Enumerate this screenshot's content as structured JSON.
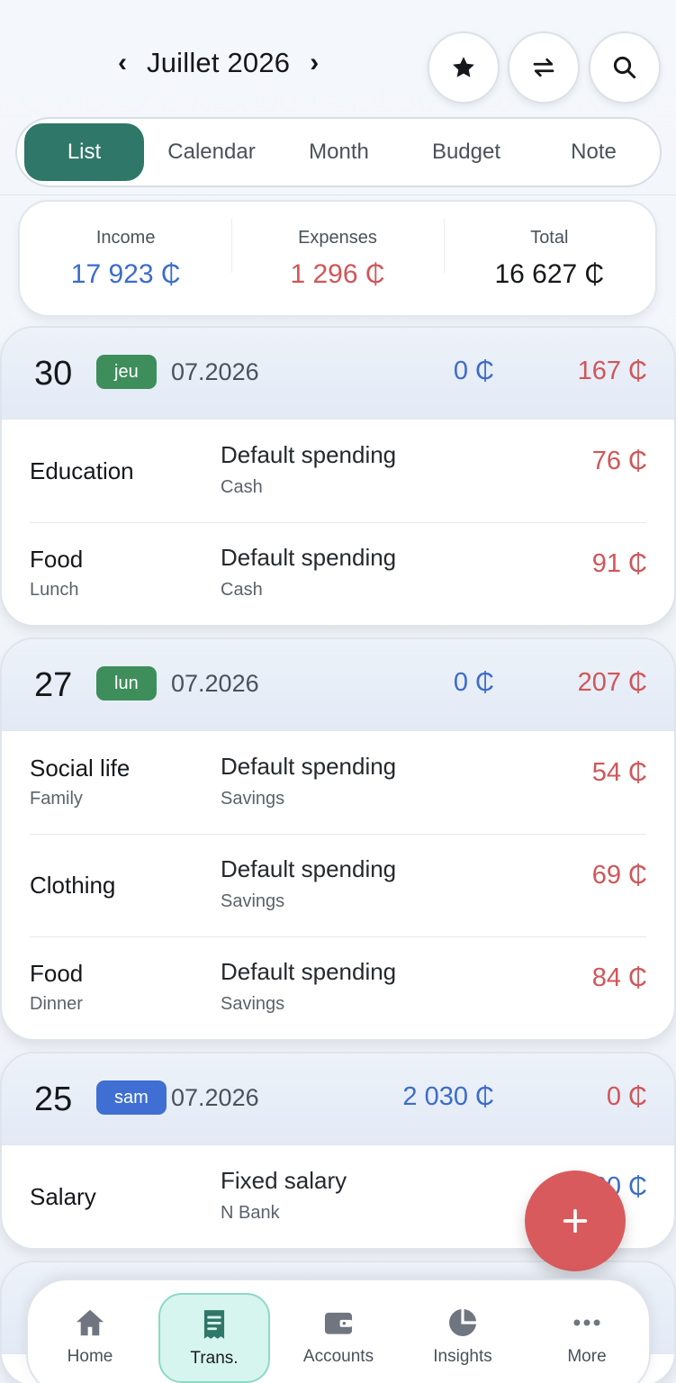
{
  "header": {
    "prev": "‹",
    "next": "›",
    "month_title": "Juillet 2026"
  },
  "tabs": [
    {
      "label": "List",
      "active": true
    },
    {
      "label": "Calendar",
      "active": false
    },
    {
      "label": "Month",
      "active": false
    },
    {
      "label": "Budget",
      "active": false
    },
    {
      "label": "Note",
      "active": false
    }
  ],
  "summary": {
    "income_label": "Income",
    "income_value": "17 923 ₵",
    "expenses_label": "Expenses",
    "expenses_value": "1 296 ₵",
    "total_label": "Total",
    "total_value": "16 627 ₵"
  },
  "days": [
    {
      "day": "30",
      "weekday": "jeu",
      "date": "07.2026",
      "income": "0 ₵",
      "expense": "167 ₵",
      "rows": [
        {
          "category": "Education",
          "subcategory": "",
          "account_title": "Default spending",
          "account": "Cash",
          "amount": "76 ₵"
        },
        {
          "category": "Food",
          "subcategory": "Lunch",
          "account_title": "Default spending",
          "account": "Cash",
          "amount": "91 ₵"
        }
      ]
    },
    {
      "day": "27",
      "weekday": "lun",
      "date": "07.2026",
      "income": "0 ₵",
      "expense": "207 ₵",
      "rows": [
        {
          "category": "Social life",
          "subcategory": "Family",
          "account_title": "Default spending",
          "account": "Savings",
          "amount": "54 ₵"
        },
        {
          "category": "Clothing",
          "subcategory": "",
          "account_title": "Default spending",
          "account": "Savings",
          "amount": "69 ₵"
        },
        {
          "category": "Food",
          "subcategory": "Dinner",
          "account_title": "Default spending",
          "account": "Savings",
          "amount": "84 ₵"
        }
      ]
    },
    {
      "day": "25",
      "weekday": "sam",
      "date": "07.2026",
      "income": "2 030 ₵",
      "expense": "0 ₵",
      "rows": [
        {
          "category": "Salary",
          "subcategory": "",
          "account_title": "Fixed salary",
          "account": "N Bank",
          "amount": "2 030 ₵"
        }
      ]
    }
  ],
  "fab": {
    "icon": "plus-icon"
  },
  "nav": [
    {
      "label": "Home",
      "icon": "home-icon",
      "active": false
    },
    {
      "label": "Trans.",
      "icon": "receipt-icon",
      "active": true
    },
    {
      "label": "Accounts",
      "icon": "wallet-icon",
      "active": false
    },
    {
      "label": "Insights",
      "icon": "pie-chart-icon",
      "active": false
    },
    {
      "label": "More",
      "icon": "more-icon",
      "active": false
    }
  ],
  "colors": {
    "accent": "#2f7768",
    "income": "#3c6cc9",
    "expense": "#d05659",
    "fab": "#d95a5c",
    "badge_weekday": "#3e8e5b",
    "badge_saturday": "#3f6fd3"
  }
}
